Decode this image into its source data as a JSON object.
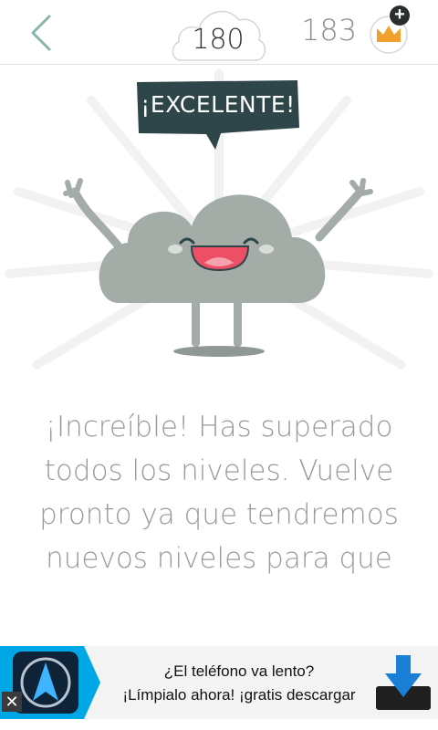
{
  "header": {
    "level": "180",
    "coins": "183",
    "plus": "+"
  },
  "bubble": {
    "text": "¡EXCELENTE!"
  },
  "message": {
    "text": "¡Increíble! Has superado todos los niveles. Vuelve pronto ya que tendremos nuevos niveles para que"
  },
  "ad": {
    "line1": "¿El teléfono va lento?",
    "line2": "¡Límpialo ahora! ¡gratis descargar",
    "close": "✕"
  },
  "colors": {
    "accent_teal": "#88b6ae",
    "cloud": "#a3aca7",
    "bubble": "#2e4649",
    "crown": "#f1a12b",
    "ad_blue": "#00a7e6"
  }
}
